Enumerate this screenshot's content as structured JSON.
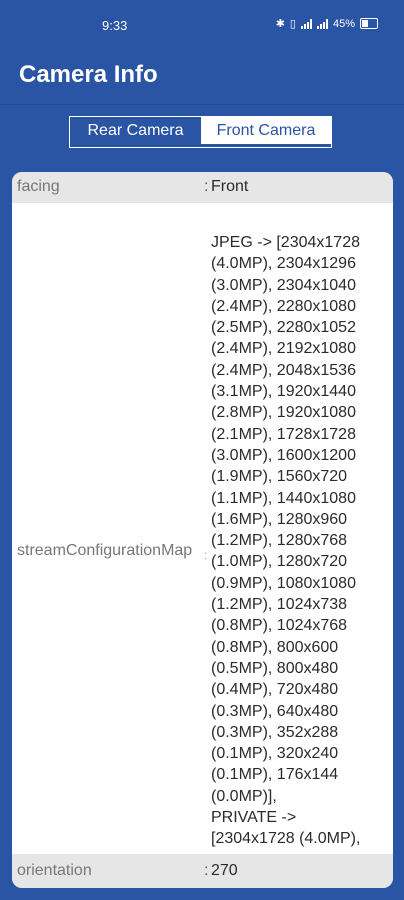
{
  "status_bar": {
    "time": "9:33",
    "battery_percent": "45%",
    "icons": [
      "bluetooth-icon",
      "vibrate-icon",
      "signal-icon",
      "signal-icon",
      "battery-icon"
    ]
  },
  "app_bar": {
    "title": "Camera Info"
  },
  "camera_tabs": [
    {
      "label": "Rear Camera",
      "selected": true
    },
    {
      "label": "Front Camera",
      "selected": false
    }
  ],
  "properties": [
    {
      "key": "facing",
      "colon": ":",
      "value": "Front"
    },
    {
      "key": "streamConfigurationMap",
      "colon": ":",
      "value": "JPEG -> [2304x1728\n(4.0MP), 2304x1296\n(3.0MP), 2304x1040\n(2.4MP), 2280x1080\n(2.5MP), 2280x1052\n(2.4MP), 2192x1080\n(2.4MP), 2048x1536\n(3.1MP), 1920x1440\n(2.8MP), 1920x1080\n(2.1MP), 1728x1728\n(3.0MP), 1600x1200\n(1.9MP), 1560x720\n(1.1MP), 1440x1080\n(1.6MP), 1280x960\n(1.2MP), 1280x768\n(1.0MP), 1280x720\n(0.9MP), 1080x1080\n(1.2MP), 1024x738\n(0.8MP), 1024x768\n(0.8MP), 800x600\n(0.5MP), 800x480\n(0.4MP), 720x480\n(0.3MP), 640x480\n(0.3MP), 352x288\n(0.1MP), 320x240\n(0.1MP), 176x144\n(0.0MP)],\nPRIVATE ->\n[2304x1728 (4.0MP),"
    },
    {
      "key": "orientation",
      "colon": ":",
      "value": "270"
    }
  ],
  "colors": {
    "background": "#2a55a4",
    "card": "#ffffff",
    "row_alt": "#e6e6e6"
  }
}
